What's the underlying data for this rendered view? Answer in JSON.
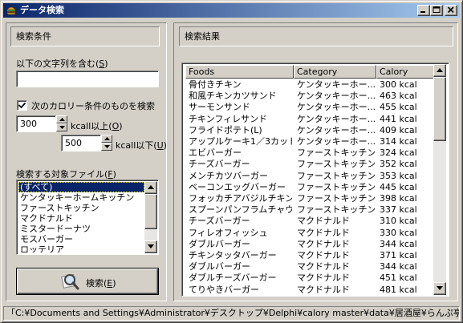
{
  "window": {
    "title": "データ検索"
  },
  "search_conditions": {
    "header": "検索条件",
    "text_label": "以下の文字列を含む(",
    "text_accel": "S",
    "text_value": "",
    "calorie_checkbox_label": "次のカロリー条件のものを検索",
    "calorie_checked": true,
    "min_value": "300",
    "min_label": "kcall以上(",
    "min_accel": "O",
    "max_value": "500",
    "max_label": "kcall以下(",
    "max_accel": "U",
    "files_label": "検索する対象ファイル(",
    "files_accel": "F",
    "files": [
      "(すべて)",
      "ケンタッキーホームキッチン",
      "ファーストキッチン",
      "マクドナルド",
      "ミスタードーナツ",
      "モスバーガー",
      "ロッテリア"
    ],
    "selected_file_index": 0,
    "search_button_label": "検索(",
    "search_button_accel": "E"
  },
  "results": {
    "header": "検索結果",
    "columns": [
      "Foods",
      "Category",
      "Calory"
    ],
    "rows": [
      [
        "骨付きチキン",
        "ケンタッキーホー...",
        "300 kcal"
      ],
      [
        "和風チキンカツサンド",
        "ケンタッキーホー...",
        "463 kcal"
      ],
      [
        "サーモンサンド",
        "ケンタッキーホー...",
        "455 kcal"
      ],
      [
        "チキンフィレサンド",
        "ケンタッキーホー...",
        "441 kcal"
      ],
      [
        "フライドポテト(L)",
        "ケンタッキーホー...",
        "409 kcal"
      ],
      [
        "アップルケーキ1／3カット",
        "ケンタッキーホー...",
        "314 kcal"
      ],
      [
        "エビバーガー",
        "ファーストキッチン",
        "324 kcal"
      ],
      [
        "チーズバーガー",
        "ファーストキッチン",
        "352 kcal"
      ],
      [
        "メンチカツバーガー",
        "ファーストキッチン",
        "353 kcal"
      ],
      [
        "ベーコンエッグバーガー",
        "ファーストキッチン",
        "445 kcal"
      ],
      [
        "フォッカチアバジルチキン",
        "ファーストキッチン",
        "398 kcal"
      ],
      [
        "スプーンパンフラムチャウダー",
        "ファーストキッチン",
        "337 kcal"
      ],
      [
        "チーズバーガー",
        "マクドナルド",
        "310 kcal"
      ],
      [
        "フィレオフィッシュ",
        "マクドナルド",
        "330 kcal"
      ],
      [
        "ダブルバーガー",
        "マクドナルド",
        "344 kcal"
      ],
      [
        "チキンタッタバーガー",
        "マクドナルド",
        "371 kcal"
      ],
      [
        "ダブルバーガー",
        "マクドナルド",
        "344 kcal"
      ],
      [
        "ダブルチーズバーガー",
        "マクドナルド",
        "451 kcal"
      ],
      [
        "てりやきバーガー",
        "マクドナルド",
        "481 kcal"
      ]
    ]
  },
  "status": {
    "text": "「C:¥Documents and Settings¥Administrator¥デスクトップ¥Delphi¥calory master¥data¥居酒屋¥らんぷ亭.cal」を検"
  },
  "colors": {
    "titlebar_start": "#0a246a",
    "titlebar_end": "#a6caf0",
    "face": "#d4d0c8",
    "selection": "#0a246a"
  },
  "icons": {
    "app": "hamburger-app-icon",
    "search": "magnifier-icon",
    "minimize": "minimize-icon",
    "maximize": "maximize-icon",
    "close": "close-icon"
  }
}
